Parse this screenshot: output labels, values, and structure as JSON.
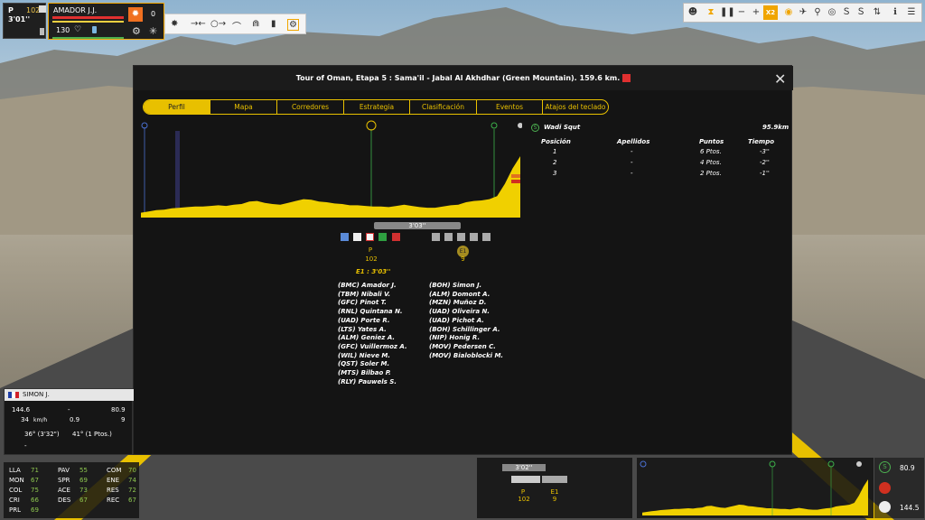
{
  "top_left": {
    "pos": "P",
    "num": "102",
    "time": "3'01''"
  },
  "rider_panel": {
    "name": "AMADOR J.J.",
    "energy": "130",
    "attack_count": "0"
  },
  "modal": {
    "title": "Tour of Oman, Etapa 5 : Sama'il - Jabal Al Akhdhar (Green Mountain). 159.6 km.",
    "tabs": [
      "Perfil",
      "Mapa",
      "Corredores",
      "Estrategia",
      "Clasificación",
      "Eventos",
      "Atajos del teclado"
    ],
    "gap_bar": "3'03''",
    "pl_p": "P",
    "pl_p_num": "102",
    "pl_e1": "E1",
    "pl_e1_num": "9",
    "gap_note": "E1 : 3'03''",
    "riders_left": [
      "(BMC) Amador J.",
      "(TBM) Nibali V.",
      "(GFC) Pinot T.",
      "(RNL) Quintana N.",
      "(UAD) Porte R.",
      "(LTS) Yates A.",
      "(ALM) Geniez A.",
      "(GFC) Vuillermoz A.",
      "(WIL) Nieve M.",
      "(QST) Soler M.",
      "(MTS) Bilbao P.",
      "(RLY) Pauwels S."
    ],
    "riders_right": [
      "(BOH) Simon J.",
      "(ALM) Domont A.",
      "(MZN) Muñoz D.",
      "(UAD) Oliveira N.",
      "(UAD) Pichot A.",
      "(BOH) Schillinger A.",
      "(NIP) Honig R.",
      "(MOV) Pedersen C.",
      "(MOV) Bialoblocki M."
    ],
    "sprint": {
      "badge": "S",
      "name": "Wadi Squt",
      "distance": "95.9km",
      "headers": [
        "Posición",
        "Apellidos",
        "Puntos",
        "Tiempo"
      ],
      "rows": [
        {
          "pos": "1",
          "name": "-",
          "points": "6 Ptos.",
          "time": "-3''"
        },
        {
          "pos": "2",
          "name": "-",
          "points": "4 Ptos.",
          "time": "-2''"
        },
        {
          "pos": "3",
          "name": "-",
          "points": "2 Ptos.",
          "time": "-1''"
        }
      ]
    }
  },
  "profile_elevation": [
    0.08,
    0.1,
    0.12,
    0.13,
    0.15,
    0.16,
    0.17,
    0.18,
    0.18,
    0.19,
    0.2,
    0.19,
    0.21,
    0.22,
    0.26,
    0.27,
    0.24,
    0.22,
    0.21,
    0.24,
    0.27,
    0.3,
    0.29,
    0.26,
    0.25,
    0.23,
    0.22,
    0.2,
    0.2,
    0.19,
    0.18,
    0.18,
    0.17,
    0.19,
    0.21,
    0.19,
    0.17,
    0.16,
    0.16,
    0.18,
    0.2,
    0.21,
    0.25,
    0.27,
    0.28,
    0.3,
    0.35,
    0.55,
    0.8,
    1.0
  ],
  "card": {
    "name": "SIMON J.",
    "dist": "144.6",
    "dash": "-",
    "right_val": "80.9",
    "speed": "34",
    "speed_unit": "km/h",
    "grade": "0.9",
    "nine": "9",
    "temp1": "36° (3'32\")",
    "temp2": "41° (1 Ptos.)",
    "dash2": "-"
  },
  "stats": [
    {
      "k": "LLA",
      "v": "71"
    },
    {
      "k": "MON",
      "v": "67"
    },
    {
      "k": "COL",
      "v": "75"
    },
    {
      "k": "CRI",
      "v": "66"
    },
    {
      "k": "PRL",
      "v": "69"
    },
    {
      "k": "PAV",
      "v": "55"
    },
    {
      "k": "SPR",
      "v": "69"
    },
    {
      "k": "ACE",
      "v": "73"
    },
    {
      "k": "DES",
      "v": "67"
    },
    {
      "k": "COM",
      "v": "70"
    },
    {
      "k": "ENE",
      "v": "74"
    },
    {
      "k": "RES",
      "v": "72"
    },
    {
      "k": "REC",
      "v": "67"
    }
  ],
  "bottom": {
    "gap": "3'02''",
    "p": "P",
    "p_num": "102",
    "e1": "E1",
    "e1_num": "9",
    "sprint_val": "80.9",
    "finish_val": "144.5"
  }
}
